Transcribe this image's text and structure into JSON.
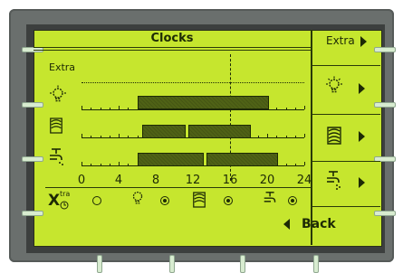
{
  "title": "Clocks",
  "side_menu": {
    "extra_label": "Extra"
  },
  "chart_label": "Extra",
  "bottom": {
    "x_label": "X",
    "x_sup": "tra",
    "back_label": "Back"
  },
  "chart_data": {
    "type": "bar",
    "x_ticks": [
      "0",
      "4",
      "8",
      "12",
      "16",
      "20",
      "24"
    ],
    "xlim": [
      0,
      24
    ],
    "current_time": 16,
    "series": [
      {
        "icon": "lightbulb-icon",
        "intervals": [
          [
            6,
            20
          ]
        ]
      },
      {
        "icon": "fan-heater-icon",
        "intervals": [
          [
            6.5,
            11
          ],
          [
            11.5,
            18
          ]
        ]
      },
      {
        "icon": "shower-tap-icon",
        "intervals": [
          [
            6,
            13
          ],
          [
            13.5,
            21
          ]
        ]
      }
    ]
  },
  "radios": [
    {
      "icon": "extra-icon",
      "selected": false
    },
    {
      "icon": "lightbulb-icon",
      "selected": true
    },
    {
      "icon": "fan-heater-icon",
      "selected": true
    },
    {
      "icon": "shower-tap-icon",
      "selected": true
    }
  ],
  "colors": {
    "screen": "#c6e62e",
    "ink": "#1d2a05",
    "bar": "#4f6216"
  }
}
